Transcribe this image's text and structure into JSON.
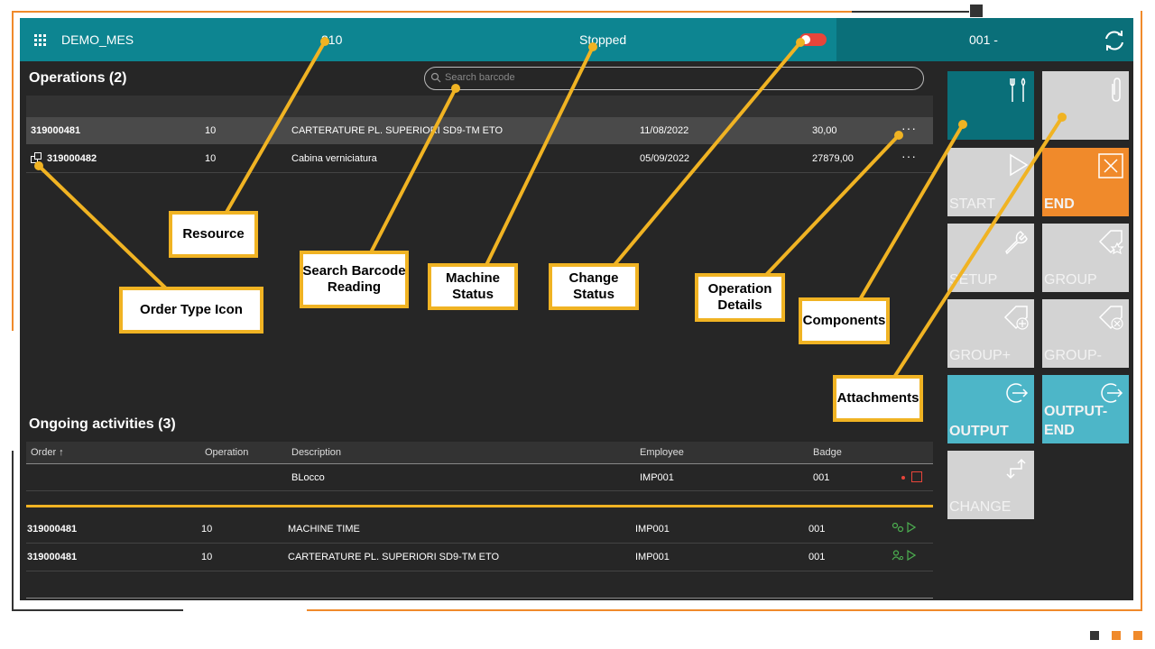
{
  "topbar": {
    "app_name": "DEMO_MES",
    "resource": "310",
    "machine_status": "Stopped",
    "operator_code": "001 -"
  },
  "operations": {
    "title": "Operations (2)",
    "search_placeholder": "Search barcode",
    "rows": [
      {
        "order": "319000481",
        "op": "10",
        "desc": "CARTERATURE PL. SUPERIORI SD9-TM ETO",
        "date": "11/08/2022",
        "qty": "30,00"
      },
      {
        "order": "319000482",
        "op": "10",
        "desc": "Cabina verniciatura",
        "date": "05/09/2022",
        "qty": "27879,00"
      }
    ],
    "more": "···"
  },
  "activities": {
    "title": "Ongoing activities  (3)",
    "headers": {
      "order": "Order ↑",
      "operation": "Operation",
      "description": "Description",
      "employee": "Employee",
      "badge": "Badge"
    },
    "block_row": {
      "desc": "BLocco",
      "employee": "IMP001",
      "badge": "001"
    },
    "rows": [
      {
        "order": "319000481",
        "op": "10",
        "desc": "MACHINE TIME",
        "employee": "IMP001",
        "badge": "001"
      },
      {
        "order": "319000481",
        "op": "10",
        "desc": "CARTERATURE PL. SUPERIORI SD9-TM ETO",
        "employee": "IMP001",
        "badge": "001"
      }
    ]
  },
  "panel": {
    "start": "START",
    "end": "END",
    "setup": "SETUP",
    "group": "GROUP",
    "group_plus": "GROUP+",
    "group_minus": "GROUP-",
    "output": "OUTPUT",
    "output_end": "OUTPUT-\nEND",
    "change": "CHANGE"
  },
  "annotations": {
    "resource": "Resource",
    "search_barcode": "Search Barcode\nReading",
    "machine_status": "Machine\nStatus",
    "change_status": "Change\nStatus",
    "operation_details": "Operation\nDetails",
    "components": "Components",
    "attachments": "Attachments",
    "order_type_icon": "Order Type Icon"
  },
  "colors": {
    "accent": "#0d8591",
    "accent_dark": "#0a6f79",
    "end": "#f08a2b",
    "output": "#4db6c8",
    "callout": "#f0b323",
    "toggle": "#e8453a"
  },
  "icons": [
    "grid-icon",
    "refresh-icon",
    "search-icon",
    "toggle-switch",
    "order-type-icon",
    "components-icon",
    "attachment-icon",
    "play-icon",
    "close-icon",
    "wrench-icon",
    "tag-star-icon",
    "tag-plus-icon",
    "tag-x-icon",
    "output-icon",
    "change-icon",
    "stop-icon",
    "machine-icon",
    "person-icon"
  ]
}
